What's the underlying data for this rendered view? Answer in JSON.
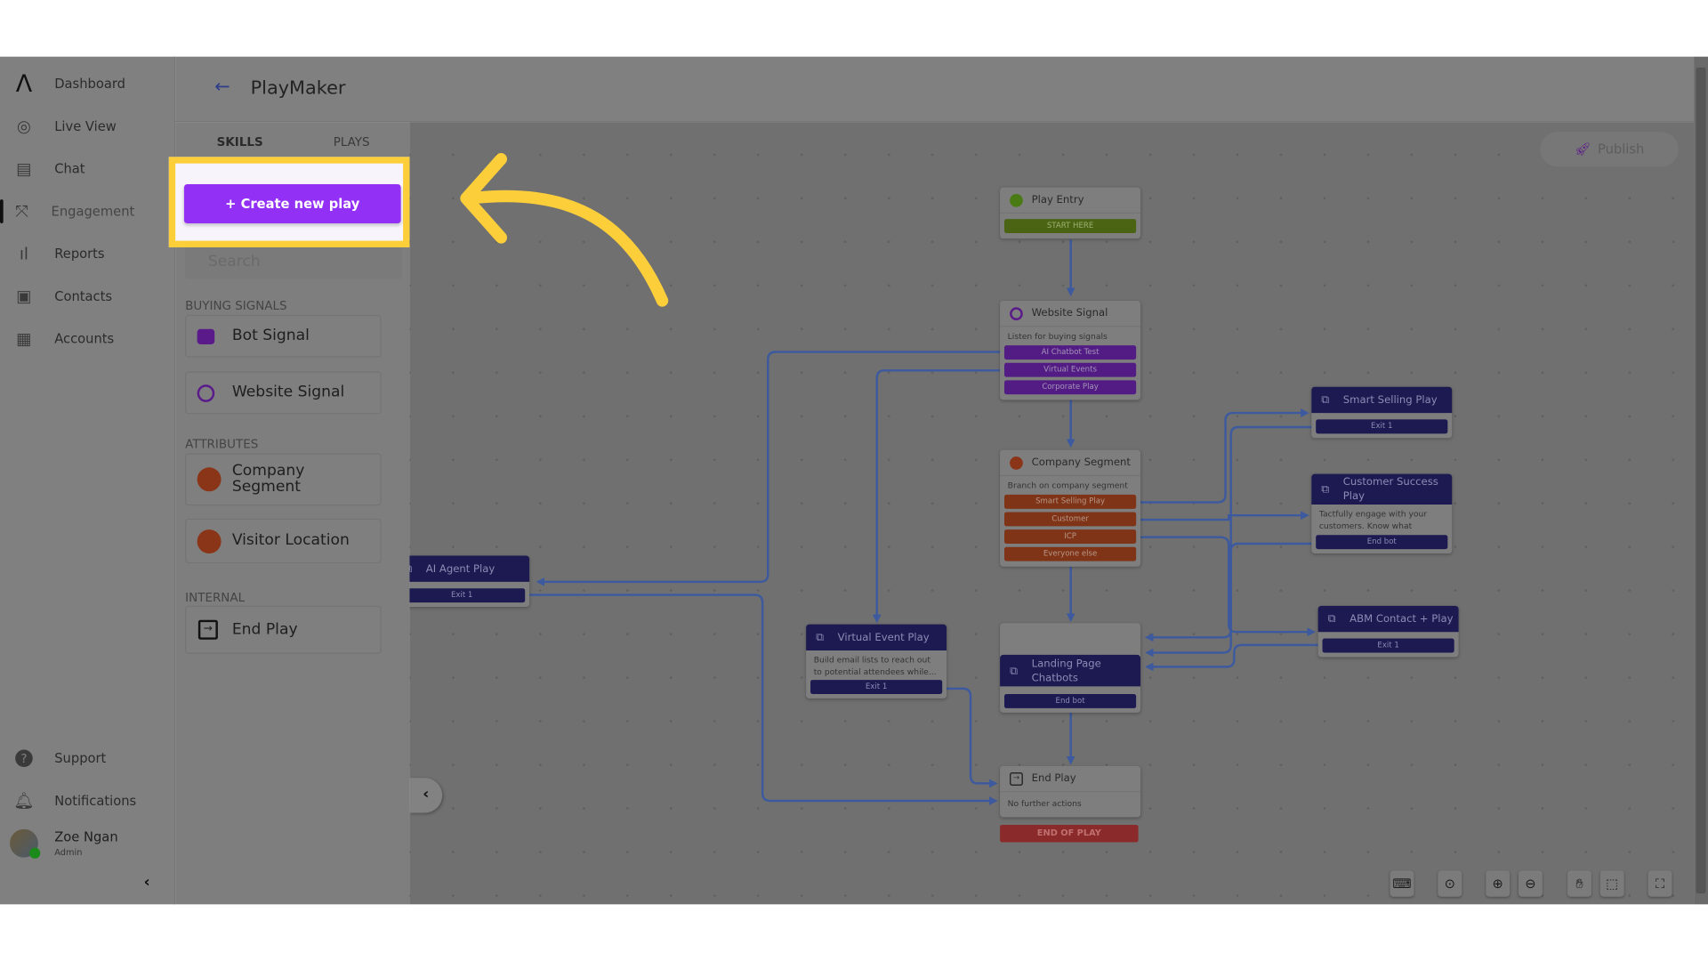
{
  "sidebar": {
    "items": [
      {
        "label": "Dashboard",
        "icon": "logo-icon"
      },
      {
        "label": "Live View",
        "icon": "live-view-icon"
      },
      {
        "label": "Chat",
        "icon": "chat-icon"
      },
      {
        "label": "Engagement",
        "icon": "engagement-icon",
        "active": true
      },
      {
        "label": "Reports",
        "icon": "bar-chart-icon"
      },
      {
        "label": "Contacts",
        "icon": "contacts-icon"
      },
      {
        "label": "Accounts",
        "icon": "building-icon"
      }
    ],
    "bottom": [
      {
        "label": "Support",
        "icon": "help-icon"
      },
      {
        "label": "Notifications",
        "icon": "bell-icon"
      }
    ],
    "user": {
      "name": "Zoe Ngan",
      "role": "Admin",
      "status_color": "#1a8a1a"
    }
  },
  "header": {
    "title": "PlayMaker"
  },
  "panel": {
    "tabs": [
      "SKILLS",
      "PLAYS"
    ],
    "create_label": "+ Create new play",
    "search_placeholder": "Search",
    "sections": [
      {
        "title": "BUYING SIGNALS",
        "items": [
          "Bot Signal",
          "Website Signal"
        ]
      },
      {
        "title": "ATTRIBUTES",
        "items": [
          "Company Segment",
          "Visitor Location"
        ]
      },
      {
        "title": "INTERNAL",
        "items": [
          "End Play"
        ]
      }
    ]
  },
  "canvas": {
    "publish_label": "Publish",
    "nodes": {
      "play_entry": {
        "title": "Play Entry",
        "bars": [
          "START HERE"
        ]
      },
      "website_signal": {
        "title": "Website Signal",
        "desc": "Listen for buying signals",
        "bars": [
          "AI Chatbot Test",
          "Virtual Events",
          "Corporate Play"
        ]
      },
      "company_segment": {
        "title": "Company Segment",
        "desc": "Branch on company segment",
        "bars": [
          "Smart Selling Play",
          "Customer",
          "ICP",
          "Everyone else"
        ]
      },
      "smart_selling": {
        "title": "Smart Selling Play",
        "bars": [
          "Exit 1"
        ]
      },
      "customer_success": {
        "title": "Customer Success Play",
        "desc": "Tactfully engage with your customers. Know what pages...",
        "bars": [
          "End bot"
        ]
      },
      "abm_contact": {
        "title": "ABM Contact + Play",
        "bars": [
          "Exit 1"
        ]
      },
      "landing_page": {
        "title": "Landing Page Chatbots",
        "bars": [
          "End bot"
        ]
      },
      "virtual_event": {
        "title": "Virtual Event Play",
        "desc": "Build email lists to reach out to potential attendees while...",
        "bars": [
          "Exit 1"
        ]
      },
      "ai_agent": {
        "title": "AI Agent Play",
        "bars": [
          "Exit 1"
        ]
      },
      "end_play": {
        "title": "End Play",
        "desc": "No further actions",
        "footer": "END OF PLAY"
      }
    }
  },
  "colors": {
    "accent": "#9230f5",
    "highlight": "#fccf3a",
    "edge": "#3d5a9e"
  }
}
